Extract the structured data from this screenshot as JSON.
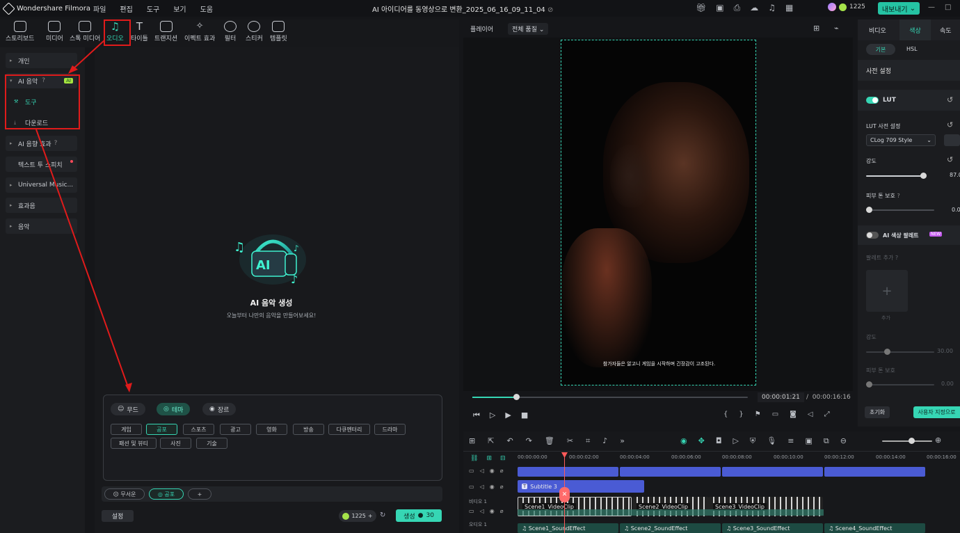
{
  "app": {
    "name": "Wondershare Filmora",
    "doc_title": "AI 아이디어를 동영상으로 변환_2025_06_16_09_11_04"
  },
  "menu": [
    "파일",
    "편집",
    "도구",
    "보기",
    "도움"
  ],
  "credit_count": "1225",
  "export_label": "내보내기",
  "toolbar": {
    "items": [
      {
        "label": "스토리보드",
        "icon": "storyboard-icon"
      },
      {
        "label": "미디어",
        "icon": "media-icon"
      },
      {
        "label": "스톡 미디어",
        "icon": "stock-media-icon"
      },
      {
        "label": "오디오",
        "icon": "music-note-icon"
      },
      {
        "label": "타이틀",
        "icon": "title-text-icon"
      },
      {
        "label": "트랜지션",
        "icon": "transition-icon"
      },
      {
        "label": "이펙트 효과",
        "icon": "effects-icon"
      },
      {
        "label": "필터",
        "icon": "filter-icon"
      },
      {
        "label": "스티커",
        "icon": "sticker-icon"
      },
      {
        "label": "템플릿",
        "icon": "template-icon"
      }
    ]
  },
  "sidebar": {
    "items": [
      {
        "label": "개인"
      },
      {
        "label": "AI 음악",
        "badge": "AI"
      },
      {
        "label": "도구"
      },
      {
        "label": "다운로드"
      },
      {
        "label": "AI 음향 효과"
      },
      {
        "label": "텍스트 투 스피치"
      },
      {
        "label": "Universal Music..."
      },
      {
        "label": "효과음"
      },
      {
        "label": "음악"
      }
    ]
  },
  "ai_music": {
    "title": "AI 음악 생성",
    "subtitle": "오늘부터 나만의 음악을 만들어보세요!",
    "tabs": [
      "무드",
      "테마",
      "장르"
    ],
    "tags_row1": [
      "게임",
      "공포",
      "스포츠",
      "광고",
      "영화",
      "방송",
      "다큐멘터리",
      "드라마"
    ],
    "tags_row2": [
      "패션 및 뷰티",
      "사진",
      "기술"
    ],
    "selected": [
      "무서운",
      "공포"
    ],
    "add": "+",
    "settings": "설정",
    "credits": "1225",
    "generate": "생성",
    "generate_cost": "30"
  },
  "preview": {
    "player_label": "플레이어",
    "quality": "전체 품질",
    "subtitle_text": "참가자들은 알고니 게임을 시작하며 긴장감이 고조된다.",
    "current_time": "00:00:01:21",
    "total_time": "00:00:16:16",
    "progress": 0.16
  },
  "right_panel": {
    "tabs": [
      "비디오",
      "색상",
      "속도"
    ],
    "subtabs": [
      "기본",
      "HSL"
    ],
    "preset": "사전 설정",
    "lut": "LUT",
    "lut_setting": "LUT 사전 설정",
    "lut_value": "CLog 709 Style",
    "intensity": "강도",
    "intensity_value": "87.0",
    "skin": "피부 톤 보호",
    "skin_value": "0.00",
    "ai_palette": "AI 색상 팔레트",
    "new_badge": "NEW",
    "add_palette": "팔레트 추가",
    "add_label": "추가",
    "intensity2": "강도",
    "intensity2_value": "30.00",
    "skin2": "피부 톤 보호",
    "skin2_value": "0.00",
    "reset": "초기화",
    "custom": "사용자 지정으로"
  },
  "timeline": {
    "ticks": [
      "00:00:00:00",
      "00:00:02:00",
      "00:00:04:00",
      "00:00:06:00",
      "00:00:08:00",
      "00:00:10:00",
      "00:00:12:00",
      "00:00:14:00",
      "00:00:16:00"
    ],
    "subtitle_clip": "Subtitle 3",
    "video_label": "비디오 1",
    "audio_label": "오디오 1",
    "video_clips": [
      "Scene1_VideoClip",
      "Scene2_VideoClip",
      "Scene3_VideoClip"
    ],
    "audio_clips": [
      "Scene1_SoundEffect",
      "Scene2_SoundEffect",
      "Scene3_SoundEffect",
      "Scene4_SoundEffect"
    ]
  },
  "colors": {
    "accent": "#36d6b4",
    "annotation": "#e01b1b",
    "clip_blue": "#4a5bd4"
  }
}
